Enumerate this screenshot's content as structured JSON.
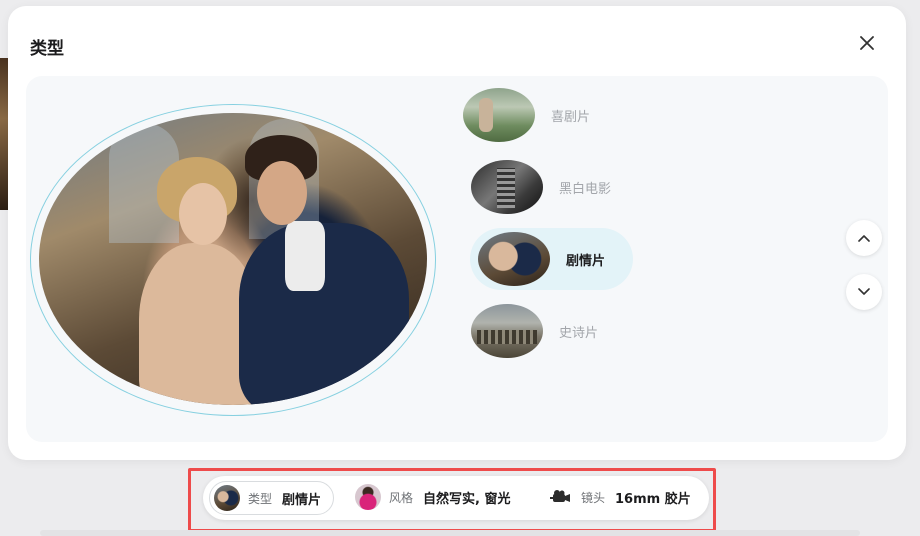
{
  "modal": {
    "title": "类型"
  },
  "genres": [
    {
      "label": "喜剧片",
      "thumb": "comedy",
      "active": false
    },
    {
      "label": "黑白电影",
      "thumb": "bw",
      "active": false
    },
    {
      "label": "剧情片",
      "thumb": "drama",
      "active": true
    },
    {
      "label": "史诗片",
      "thumb": "epic",
      "active": false
    }
  ],
  "selection_bar": {
    "type": {
      "key": "类型",
      "value": "剧情片"
    },
    "style": {
      "key": "风格",
      "value": "自然写实, 窗光"
    },
    "lens": {
      "key": "镜头",
      "value": "16mm 胶片"
    }
  },
  "icons": {
    "close": "close-icon",
    "up": "chevron-up-icon",
    "down": "chevron-down-icon",
    "camera": "camera-icon"
  },
  "colors": {
    "active_bg": "#e3f3f8",
    "ring": "#86d0e0",
    "highlight": "#ee4b4b"
  }
}
